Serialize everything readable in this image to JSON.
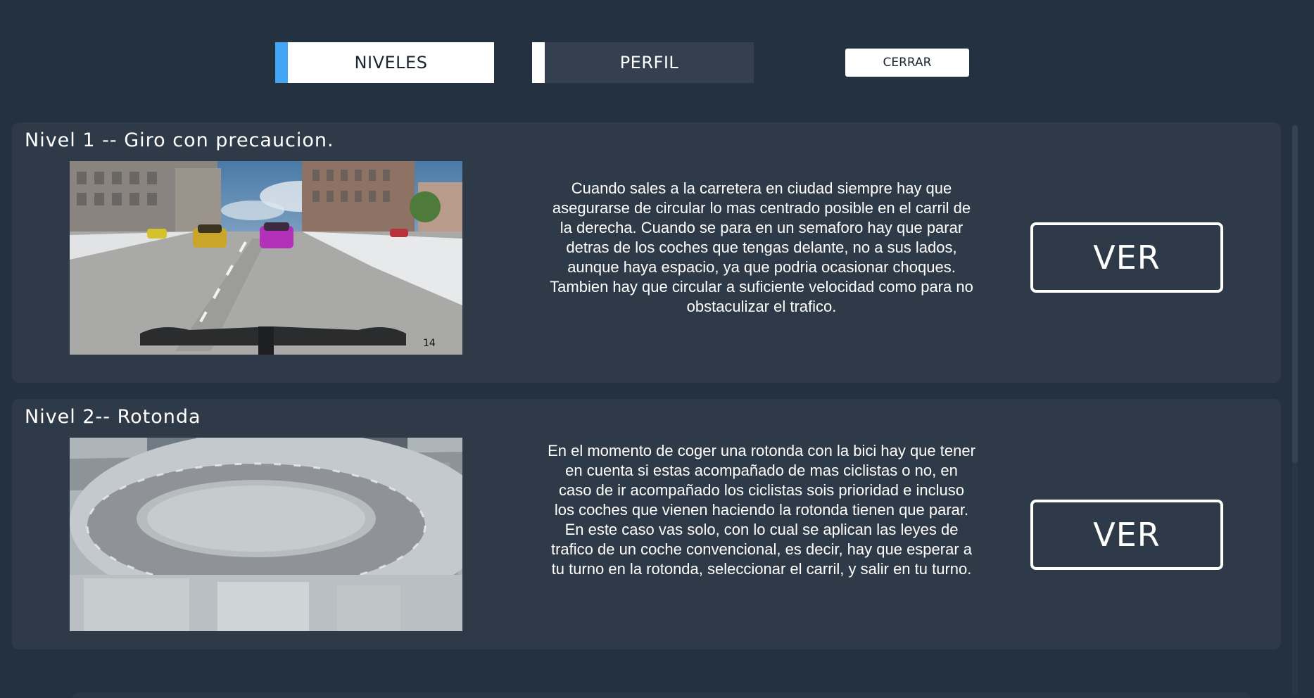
{
  "tabs": [
    {
      "label": "NIVELES",
      "active": true
    },
    {
      "label": "PERFIL",
      "active": false
    }
  ],
  "close_label": "CERRAR",
  "levels": [
    {
      "title": "Nivel 1 -- Giro con precaucion.",
      "description": "Cuando sales a la carretera en ciudad siempre hay que asegurarse de circular lo mas centrado posible en el carril de la derecha. Cuando se para en un semaforo hay que parar detras de los coches que tengas delante, no a sus lados, aunque haya espacio, ya que podria ocasionar choques.\nTambien hay que circular a suficiente velocidad como para no obstaculizar el trafico.",
      "button_label": "VER",
      "hud_value": "14"
    },
    {
      "title": "Nivel 2-- Rotonda",
      "description": "En el momento de coger una rotonda con la bici hay que tener en cuenta si estas acompañado de mas ciclistas o no, en caso de ir acompañado los ciclistas sois prioridad e incluso los coches que vienen haciendo la rotonda tienen que parar.\nEn este caso vas solo, con lo cual se aplican las leyes de trafico de un coche convencional, es decir, hay que esperar a tu turno en la rotonda, seleccionar el carril, y salir en tu turno.",
      "button_label": "VER"
    }
  ],
  "colors": {
    "background": "#243140",
    "card": "#2f3a48",
    "active_tab_accent": "#42a5f5"
  }
}
